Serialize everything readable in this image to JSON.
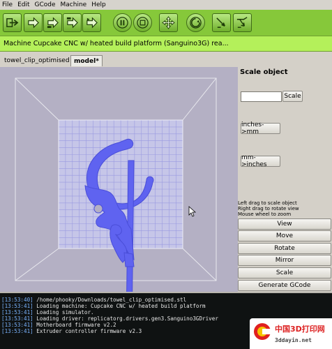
{
  "menu": [
    "File",
    "Edit",
    "GCode",
    "Machine",
    "Help"
  ],
  "toolbar": {
    "buttons": [
      {
        "icon": "import-arrow-icon"
      },
      {
        "icon": "arrow-right-icon-1"
      },
      {
        "icon": "arrow-right-icon-2"
      },
      {
        "icon": "arrow-right-icon-3"
      },
      {
        "icon": "arrow-right-icon-4"
      },
      {
        "icon": "pause-icon"
      },
      {
        "icon": "stop-icon"
      },
      {
        "icon": "move-arrows-icon"
      },
      {
        "icon": "reset-icon"
      },
      {
        "icon": "extruder-icon"
      },
      {
        "icon": "extruder-advanced-icon"
      }
    ],
    "accent": "#86c83a"
  },
  "status": {
    "text": "Machine Cupcake CNC w/ heated build platform (Sanguino3G) rea..."
  },
  "tabs": [
    {
      "label": "towel_clip_optimised",
      "active": false
    },
    {
      "label": "model*",
      "active": true
    }
  ],
  "panel": {
    "title": "Scale object",
    "scale_input_value": "",
    "scale_button": "Scale",
    "inches_to_mm": "inches->mm",
    "mm_to_inches": "mm->inches",
    "help": [
      "Left drag to scale object",
      "Right drag to rotate view",
      "Mouse wheel to zoom"
    ],
    "modes": [
      "View",
      "Move",
      "Rotate",
      "Mirror",
      "Scale",
      "Generate GCode"
    ]
  },
  "console": [
    {
      "time": "[13:53:40]",
      "msg": "/home/phooky/Downloads/towel_clip_optimised.stl"
    },
    {
      "time": "[13:53:41]",
      "msg": "Loading machine: Cupcake CNC w/ heated build platform"
    },
    {
      "time": "[13:53:41]",
      "msg": "Loading simulator."
    },
    {
      "time": "[13:53:41]",
      "msg": "Loading driver: replicatorg.drivers.gen3.Sanguino3GDriver"
    },
    {
      "time": "[13:53:41]",
      "msg": "Motherboard firmware v2.2"
    },
    {
      "time": "[13:53:41]",
      "msg": "Extruder controller firmware v2.3"
    }
  ],
  "watermark": {
    "name": "中国3D打印网",
    "url": "3ddayin.net"
  },
  "colors": {
    "model": "#5f63f0",
    "build_plate": "#c6c6e8"
  }
}
